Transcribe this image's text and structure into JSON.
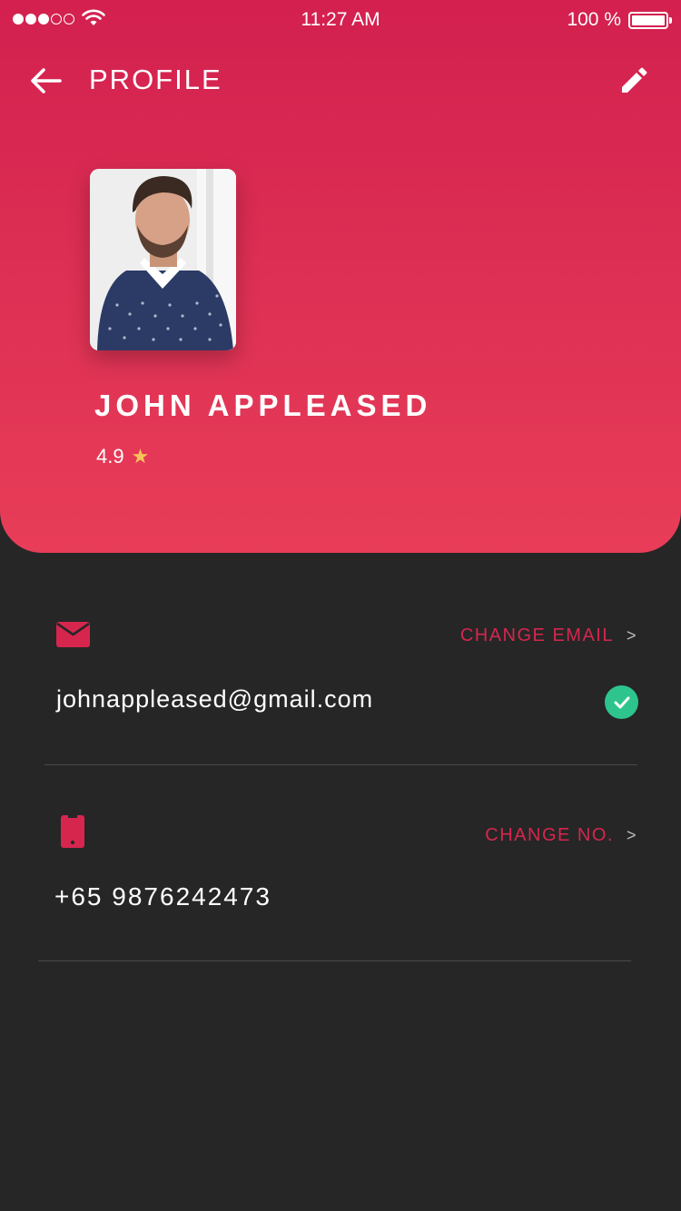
{
  "status_bar": {
    "time": "11:27 AM",
    "battery_label": "100 %",
    "signal_bars_filled": 3,
    "signal_bars_total": 5,
    "battery_level": 1.0
  },
  "nav": {
    "title": "PROFILE",
    "back_icon": "arrow-left-icon",
    "edit_icon": "pencil-icon"
  },
  "profile": {
    "name": "JOHN APPLEASED",
    "rating": "4.9",
    "rating_icon": "star-icon"
  },
  "email_section": {
    "icon": "envelope-icon",
    "action_label": "CHANGE EMAIL",
    "value": "johnappleased@gmail.com",
    "verified_icon": "checkmark-icon"
  },
  "phone_section": {
    "icon": "mobile-phone-icon",
    "action_label": "CHANGE NO.",
    "value": "+65 9876242473"
  },
  "colors": {
    "accent": "#d6264e",
    "header_top": "#d3204f",
    "header_bottom": "#e83d58",
    "background": "#262626",
    "verified": "#2ec48d",
    "star": "#f5c458"
  }
}
